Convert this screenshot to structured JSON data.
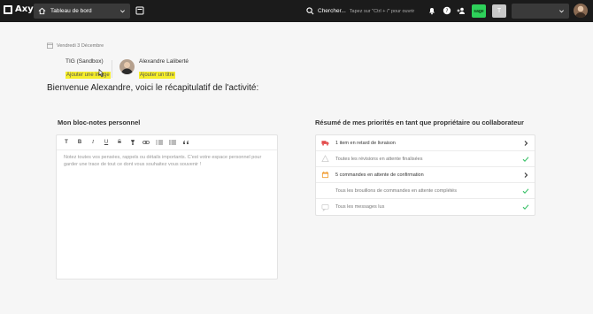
{
  "app": {
    "brand": "Axya"
  },
  "topbar": {
    "workspace_label": "Tableau de bord",
    "search_label": "Chercher...",
    "search_hint": "Tapez sur \"Ctrl + /\" pour ouvrir",
    "sage_label": "sage",
    "tile_letter": "T"
  },
  "header": {
    "date": "Vendredi 3 Décembre",
    "company_name": "TIG (Sandbox)",
    "company_action": "Ajouter une image",
    "user_name": "Alexandre Laliberté",
    "user_action": "Ajouter un titre",
    "welcome": "Bienvenue Alexandre, voici le récapitulatif de l'activité:"
  },
  "notes": {
    "title": "Mon bloc-notes personnel",
    "placeholder": "Notez toutes vos pensées, rappels ou détails importants. C'est votre espace personnel pour garder une trace de tout ce dont vous souhaitez vous souvenir !",
    "toolbar": [
      "T",
      "B",
      "I",
      "U",
      "S",
      "highlight",
      "link",
      "ordered-list",
      "bullet-list",
      "quote"
    ]
  },
  "priorities": {
    "title": "Résumé de mes priorités en tant que propriétaire ou collaborateur",
    "items": [
      {
        "label": "1 item en retard de livraison",
        "icon": "truck-icon",
        "end": "chevron-right-icon",
        "active": true
      },
      {
        "label": "Toutes les révisions en attente finalisées",
        "icon": "alert-icon",
        "end": "check-icon",
        "active": false
      },
      {
        "label": "5 commandes en attente de confirmation",
        "icon": "calendar-icon",
        "end": "chevron-right-icon",
        "active": true
      },
      {
        "label": "Tous les brouillons de commandes en attente complétés",
        "icon": "none",
        "end": "check-icon",
        "active": false
      },
      {
        "label": "Tous les messages lus",
        "icon": "chat-icon",
        "end": "check-icon",
        "active": false
      }
    ]
  },
  "colors": {
    "topbar": "#1b1b1b",
    "highlight": "#f6ee2a",
    "sage": "#2ed15a",
    "check": "#3cc26a",
    "truck": "#e34a4a",
    "calendar": "#f2a13a"
  }
}
